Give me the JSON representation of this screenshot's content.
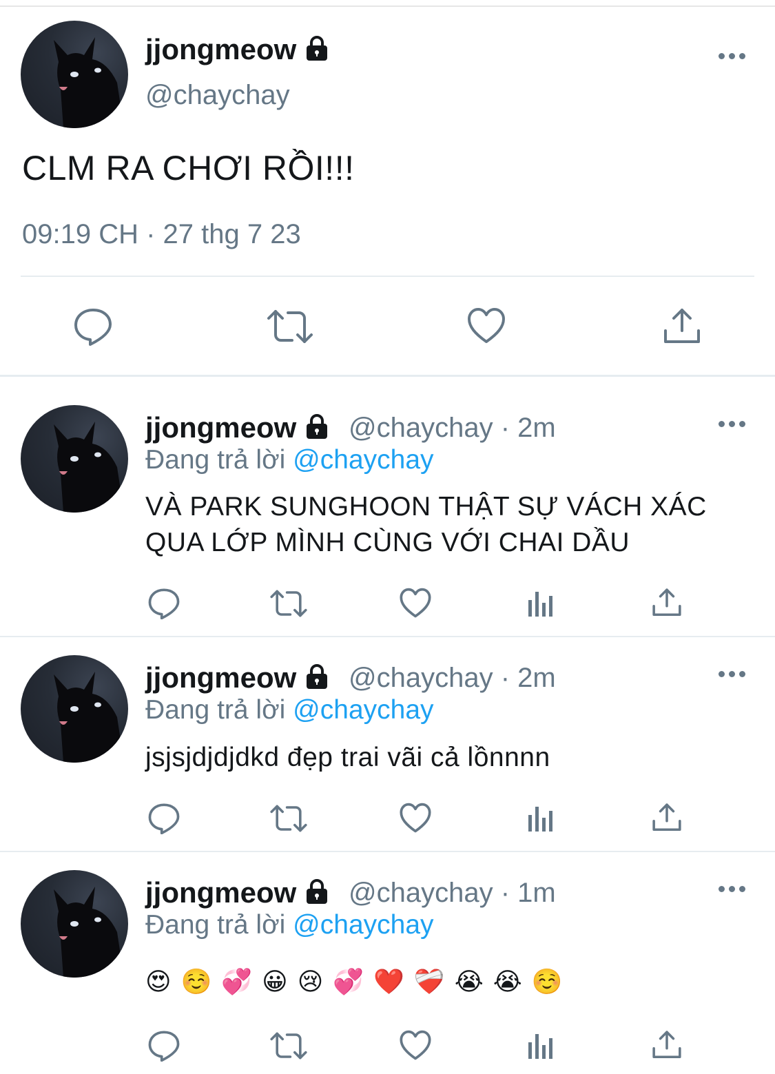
{
  "main_tweet": {
    "display_name": "jjongmeow",
    "handle": "@chaychay",
    "text": "CLM RA CHƠI RỒI!!!",
    "timestamp": "09:19 CH · 27 thg 7 23",
    "actions": [
      "reply-icon",
      "retweet-icon",
      "like-icon",
      "share-icon"
    ]
  },
  "replies": [
    {
      "display_name": "jjongmeow",
      "handle_time": "@chaychay · 2m",
      "replying_prefix": "Đang trả lời",
      "replying_to": "@chaychay",
      "text_line1": "VÀ PARK SUNGHOON THẬT SỰ VÁCH XÁC",
      "text_line2": "QUA LỚP MÌNH CÙNG VỚI CHAI DẦU"
    },
    {
      "display_name": "jjongmeow",
      "handle_time": "@chaychay · 2m",
      "replying_prefix": "Đang trả lời",
      "replying_to": "@chaychay",
      "text_line1": "jsjsjdjdjdkd đẹp trai vãi cả lồnnnn"
    },
    {
      "display_name": "jjongmeow",
      "handle_time": "@chaychay · 1m",
      "replying_prefix": "Đang trả lời",
      "replying_to": "@chaychay",
      "emojis": "😍☺️💞😀😢💞❤️❤️‍🩹😭😭☺️"
    }
  ],
  "colors": {
    "text": "#14171a",
    "secondary": "#657786",
    "link": "#1da1f2",
    "divider": "#e6ecf0"
  }
}
